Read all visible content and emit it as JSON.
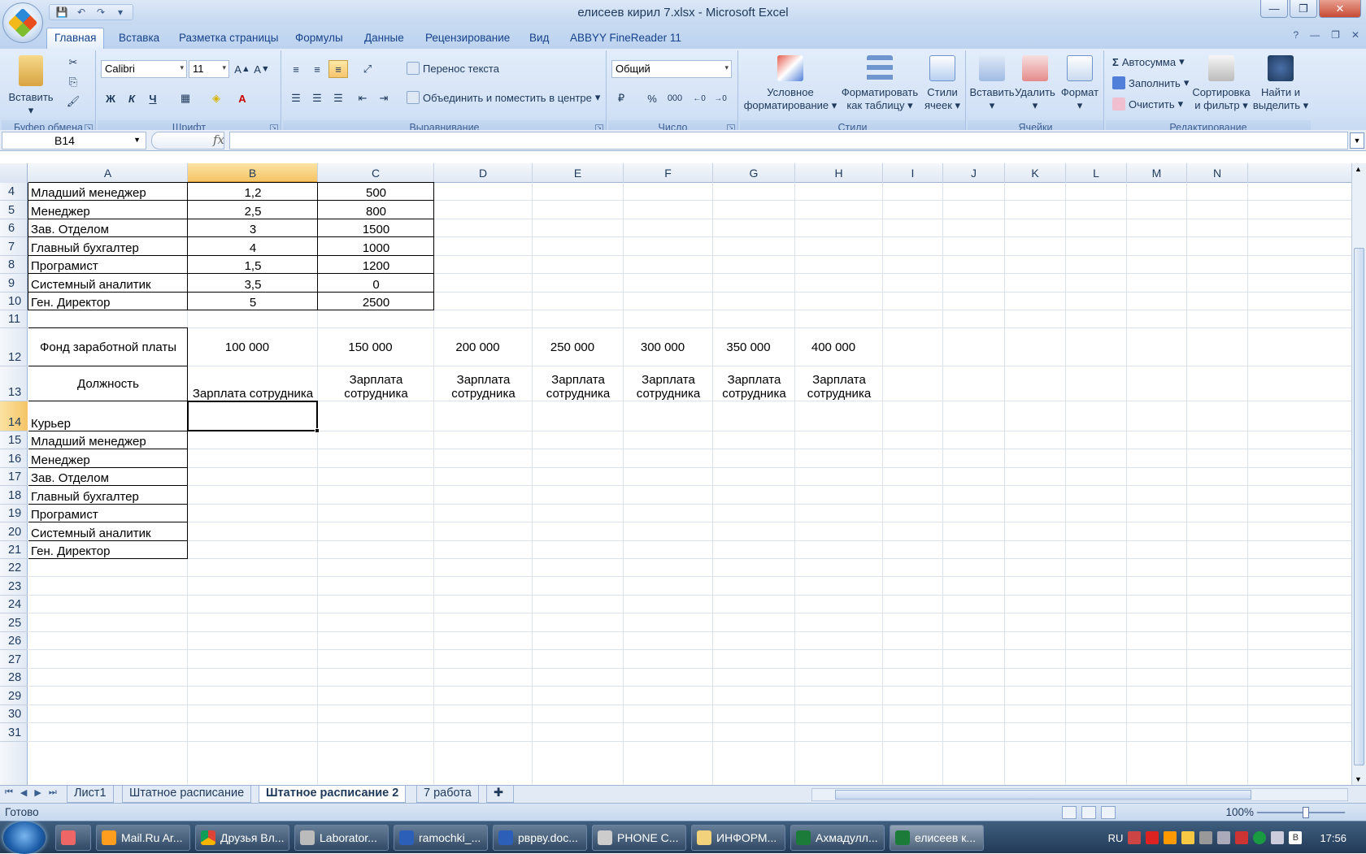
{
  "title": "елисеев кирил 7.xlsx - Microsoft Excel",
  "ribbon": {
    "tabs": [
      "Главная",
      "Вставка",
      "Разметка страницы",
      "Формулы",
      "Данные",
      "Рецензирование",
      "Вид",
      "ABBYY FineReader 11"
    ],
    "groups": {
      "clipboard": "Буфер обмена",
      "font": "Шрифт",
      "alignment": "Выравнивание",
      "number": "Число",
      "styles": "Стили",
      "cells": "Ячейки",
      "editing": "Редактирование"
    },
    "paste": "Вставить",
    "font_name": "Calibri",
    "font_size": "11",
    "bold": "Ж",
    "italic": "К",
    "underline": "Ч",
    "wrap_text": "Перенос текста",
    "merge_center": "Объединить и поместить в центре",
    "number_format": "Общий",
    "percent": "%",
    "thousands": "000",
    "cond_format": [
      "Условное",
      "форматирование"
    ],
    "format_table": [
      "Форматировать",
      "как таблицу"
    ],
    "cell_styles": [
      "Стили",
      "ячеек"
    ],
    "insert": "Вставить",
    "delete": "Удалить",
    "format": "Формат",
    "autosum": "Автосумма",
    "fill": "Заполнить",
    "clear": "Очистить",
    "sort_filter": [
      "Сортировка",
      "и фильтр"
    ],
    "find_select": [
      "Найти и",
      "выделить"
    ]
  },
  "formula_bar": {
    "name_box": "B14",
    "fx": "fx",
    "value": ""
  },
  "columns": [
    "A",
    "B",
    "C",
    "D",
    "E",
    "F",
    "G",
    "H",
    "I",
    "J",
    "K",
    "L",
    "M",
    "N"
  ],
  "rows": [
    "4",
    "5",
    "6",
    "7",
    "8",
    "9",
    "10",
    "11",
    "12",
    "13",
    "14",
    "15",
    "16",
    "17",
    "18",
    "19",
    "20",
    "21",
    "22",
    "23",
    "24",
    "25",
    "26",
    "27",
    "28",
    "29",
    "30",
    "31"
  ],
  "table1": [
    [
      "Младший менеджер",
      "1,2",
      "500"
    ],
    [
      "Менеджер",
      "2,5",
      "800"
    ],
    [
      "Зав. Отделом",
      "3",
      "1500"
    ],
    [
      "Главный бухгалтер",
      "4",
      "1000"
    ],
    [
      "Програмист",
      "1,5",
      "1200"
    ],
    [
      "Системный аналитик",
      "3,5",
      "0"
    ],
    [
      "Ген. Директор",
      "5",
      "2500"
    ]
  ],
  "fund_label": "Фонд заработной платы",
  "fund_values": [
    "100 000",
    "150 000",
    "200 000",
    "250 000",
    "300 000",
    "350 000",
    "400 000"
  ],
  "position_label": "Должность",
  "salary_b13": "Зарплата сотрудника",
  "salary_line1": "Зарплата",
  "salary_line2": "сотрудника",
  "positions2": [
    "Курьер",
    "Младший менеджер",
    "Менеджер",
    "Зав. Отделом",
    "Главный бухгалтер",
    "Програмист",
    "Системный аналитик",
    "Ген. Директор"
  ],
  "sheets": [
    "Лист1",
    "Штатное расписание",
    "Штатное расписание 2",
    "7 работа"
  ],
  "status": {
    "ready": "Готово",
    "zoom": "100%"
  },
  "taskbar": {
    "items": [
      "Mail.Ru Ar...",
      "Друзья Вл...",
      "Laborator...",
      "ramochki_...",
      "рврву.doc...",
      "PHONE C...",
      "ИНФОРМ...",
      "Ахмадулл...",
      "елисеев к..."
    ],
    "lang": "RU",
    "clock": "17:56"
  }
}
